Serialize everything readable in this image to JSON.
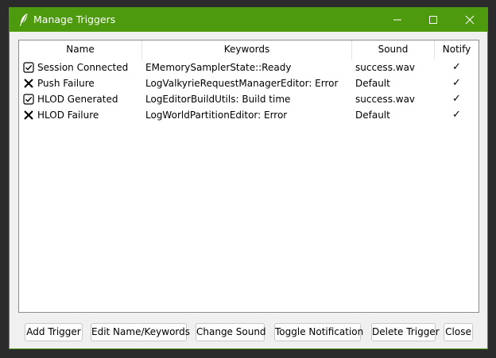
{
  "window": {
    "title": "Manage Triggers",
    "icon": "feather-icon",
    "accent": "#4e9a0e"
  },
  "table": {
    "columns": [
      "Name",
      "Keywords",
      "Sound",
      "Notify"
    ],
    "rows": [
      {
        "enabled": true,
        "status_icon": "checkbox-checked-icon",
        "name": "Session Connected",
        "keywords": "EMemorySamplerState::Ready",
        "sound": "success.wav",
        "notify": "✓"
      },
      {
        "enabled": false,
        "status_icon": "x-icon",
        "name": "Push Failure",
        "keywords": "LogValkyrieRequestManagerEditor: Error",
        "sound": "Default",
        "notify": "✓"
      },
      {
        "enabled": true,
        "status_icon": "checkbox-checked-icon",
        "name": "HLOD Generated",
        "keywords": "LogEditorBuildUtils: Build time",
        "sound": "success.wav",
        "notify": "✓"
      },
      {
        "enabled": false,
        "status_icon": "x-icon",
        "name": "HLOD Failure",
        "keywords": "LogWorldPartitionEditor: Error",
        "sound": "Default",
        "notify": "✓"
      }
    ]
  },
  "buttons": {
    "add": "Add Trigger",
    "edit": "Edit Name/Keywords",
    "change_sound": "Change Sound",
    "toggle_notification": "Toggle Notification",
    "delete": "Delete Trigger",
    "close": "Close"
  }
}
